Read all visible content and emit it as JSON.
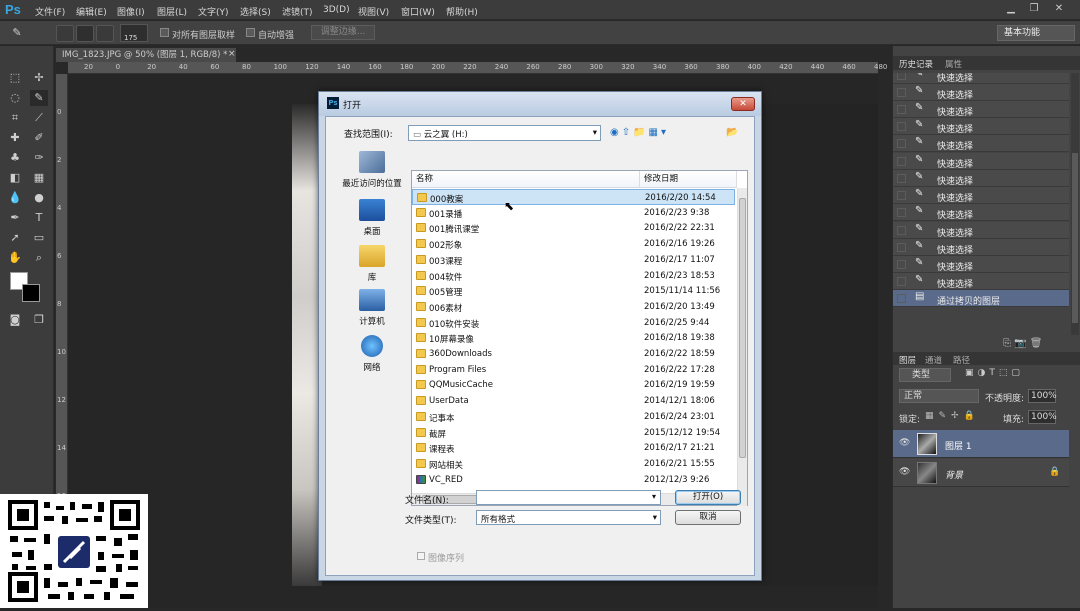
{
  "app": {
    "logo": "Ps"
  },
  "menu": [
    "文件(F)",
    "编辑(E)",
    "图像(I)",
    "图层(L)",
    "文字(Y)",
    "选择(S)",
    "滤镜(T)",
    "3D(D)",
    "视图(V)",
    "窗口(W)",
    "帮助(H)"
  ],
  "options": {
    "brush_size": "175",
    "sample_all_layers": "对所有图层取样",
    "auto_enhance": "自动增强",
    "refine_edge": "调整边缘...",
    "workspace": "基本功能"
  },
  "document": {
    "tab_title": "IMG_1823.JPG @ 50% (图层 1, RGB/8) *",
    "ruler_h": [
      "20",
      "0",
      "20",
      "40",
      "60",
      "80",
      "100",
      "120",
      "140",
      "160",
      "180",
      "200",
      "220",
      "240",
      "260",
      "280",
      "300",
      "320",
      "340",
      "360",
      "380",
      "400",
      "420",
      "440",
      "460",
      "480"
    ],
    "ruler_v": [
      "0",
      "2",
      "4",
      "6",
      "8",
      "10",
      "12",
      "14",
      "16",
      "18",
      "20"
    ]
  },
  "history_panel": {
    "tabs": [
      "历史记录",
      "属性"
    ],
    "items": [
      "快速选择",
      "快速选择",
      "快速选择",
      "快速选择",
      "快速选择",
      "快速选择",
      "快速选择",
      "快速选择",
      "快速选择",
      "快速选择",
      "快速选择",
      "快速选择",
      "快速选择",
      "通过拷贝的图层"
    ]
  },
  "layers_panel": {
    "tabs": [
      "图层",
      "通道",
      "路径"
    ],
    "filter_kind": "类型",
    "blend_mode": "正常",
    "opacity_label": "不透明度:",
    "opacity": "100%",
    "lock_label": "锁定:",
    "fill_label": "填充:",
    "fill": "100%",
    "layers": [
      {
        "name": "图层 1",
        "selected": true
      },
      {
        "name": "背景",
        "selected": false
      }
    ]
  },
  "dialog": {
    "title": "打开",
    "look_in_label": "查找范围(I):",
    "look_in_value": "云之翼 (H:)",
    "places": [
      "最近访问的位置",
      "桌面",
      "库",
      "计算机",
      "网络"
    ],
    "col_name": "名称",
    "col_date": "修改日期",
    "files": [
      {
        "name": "000教案",
        "date": "2016/2/20 14:54",
        "type": "folder",
        "selected": true
      },
      {
        "name": "001录播",
        "date": "2016/2/23 9:38",
        "type": "folder"
      },
      {
        "name": "001腾讯课堂",
        "date": "2016/2/22 22:31",
        "type": "folder"
      },
      {
        "name": "002形象",
        "date": "2016/2/16 19:26",
        "type": "folder"
      },
      {
        "name": "003课程",
        "date": "2016/2/17 11:07",
        "type": "folder"
      },
      {
        "name": "004软件",
        "date": "2016/2/23 18:53",
        "type": "folder"
      },
      {
        "name": "005管理",
        "date": "2015/11/14 11:56",
        "type": "folder"
      },
      {
        "name": "006素材",
        "date": "2016/2/20 13:49",
        "type": "folder"
      },
      {
        "name": "010软件安装",
        "date": "2016/2/25 9:44",
        "type": "folder"
      },
      {
        "name": "10屏幕录像",
        "date": "2016/2/18 19:38",
        "type": "folder"
      },
      {
        "name": "360Downloads",
        "date": "2016/2/22 18:59",
        "type": "folder"
      },
      {
        "name": "Program Files",
        "date": "2016/2/22 17:28",
        "type": "folder"
      },
      {
        "name": "QQMusicCache",
        "date": "2016/2/19 19:59",
        "type": "folder"
      },
      {
        "name": "UserData",
        "date": "2014/12/1 18:06",
        "type": "folder"
      },
      {
        "name": "记事本",
        "date": "2016/2/24 23:01",
        "type": "folder"
      },
      {
        "name": "截屏",
        "date": "2015/12/12 19:54",
        "type": "folder"
      },
      {
        "name": "课程表",
        "date": "2016/2/17 21:21",
        "type": "folder"
      },
      {
        "name": "网站相关",
        "date": "2016/2/21 15:55",
        "type": "folder"
      },
      {
        "name": "VC_RED",
        "date": "2012/12/3 9:26",
        "type": "archive"
      }
    ],
    "filename_label": "文件名(N):",
    "filename_value": "",
    "filetype_label": "文件类型(T):",
    "filetype_value": "所有格式",
    "open_button": "打开(O)",
    "cancel_button": "取消",
    "image_sequence": "图像序列"
  }
}
